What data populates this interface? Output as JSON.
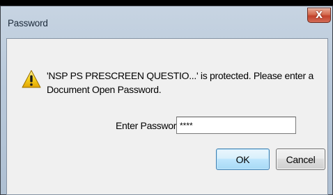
{
  "window": {
    "title": "Password",
    "close_label": "X"
  },
  "dialog": {
    "message": "'NSP PS PRESCREEN QUESTIO...' is protected. Please enter a Document Open Password.",
    "password_label": "Enter Password:",
    "password_value": "****",
    "ok_label": "OK",
    "cancel_label": "Cancel",
    "icon": "warning-icon"
  },
  "colors": {
    "accent": "#3c7fb1",
    "warning": "#f5c400",
    "close": "#c2412a"
  }
}
